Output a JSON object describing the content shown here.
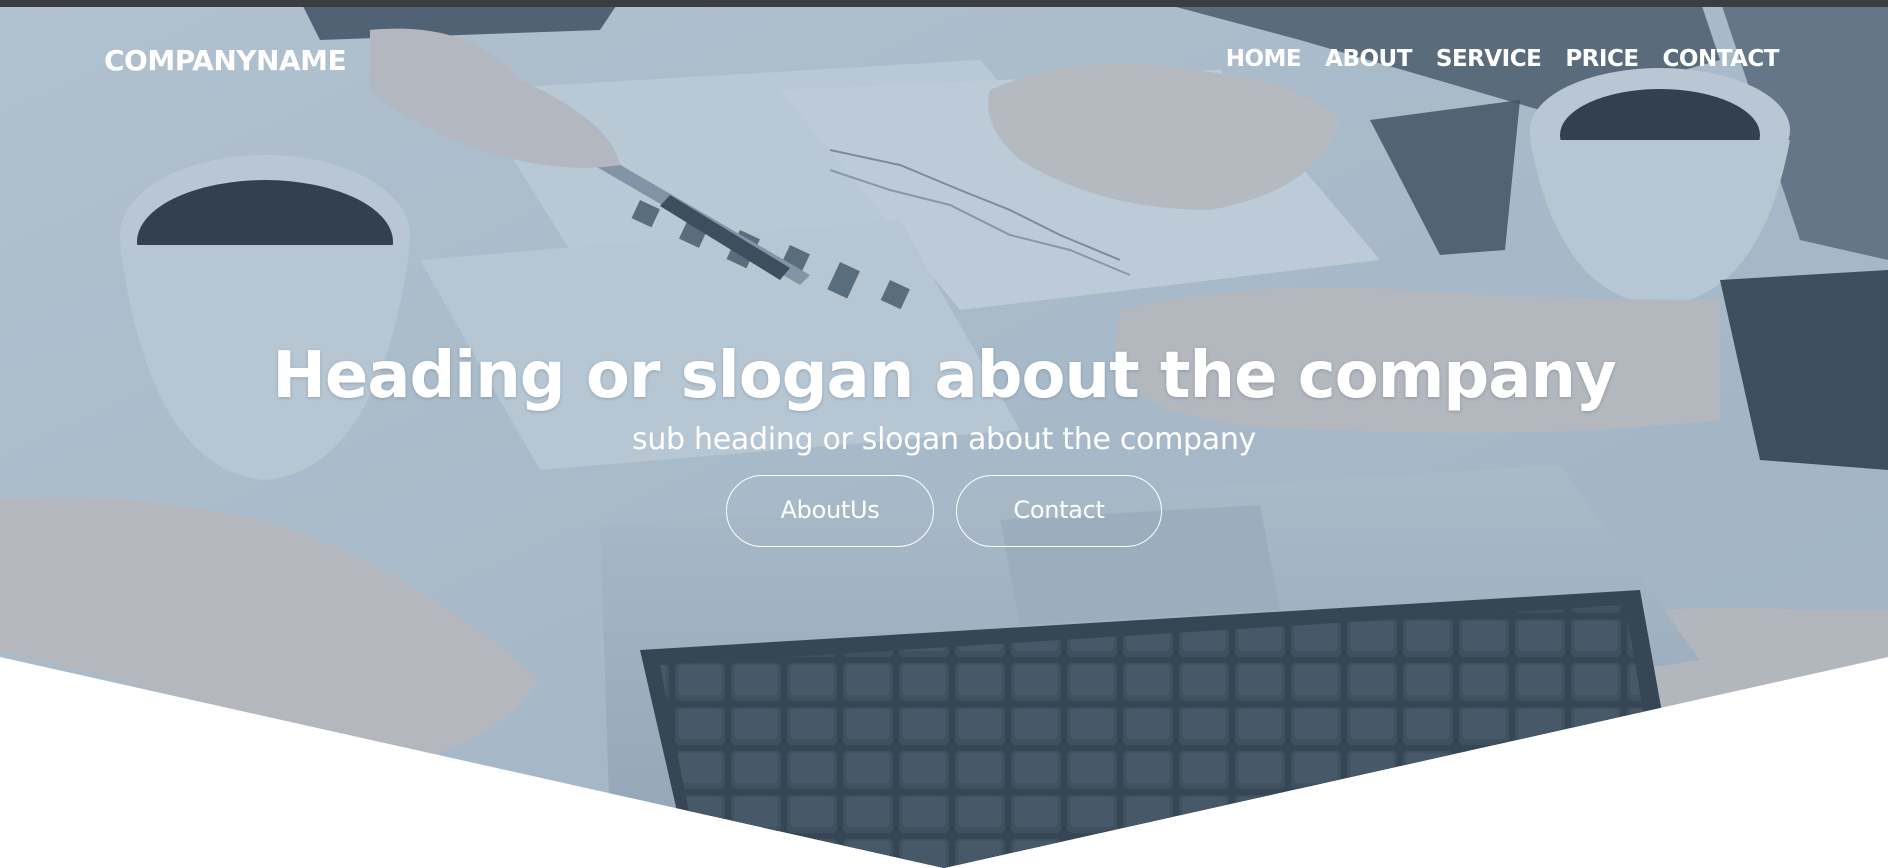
{
  "brand": {
    "name": "COMPANYNAME"
  },
  "nav": {
    "items": [
      "HOME",
      "ABOUT",
      "SERVICE",
      "PRICE",
      "CONTACT"
    ]
  },
  "hero": {
    "heading": "Heading or slogan about the company",
    "subheading": "sub heading or slogan about the company",
    "buttons": {
      "about_label": "AboutUs",
      "contact_label": "Contact"
    },
    "overlay_color": "#5c80a0",
    "background_description_icon": "business-meeting-photo"
  },
  "colors": {
    "topbar": "#3b3d41",
    "text": "#ffffff",
    "page_bg": "#ffffff"
  }
}
